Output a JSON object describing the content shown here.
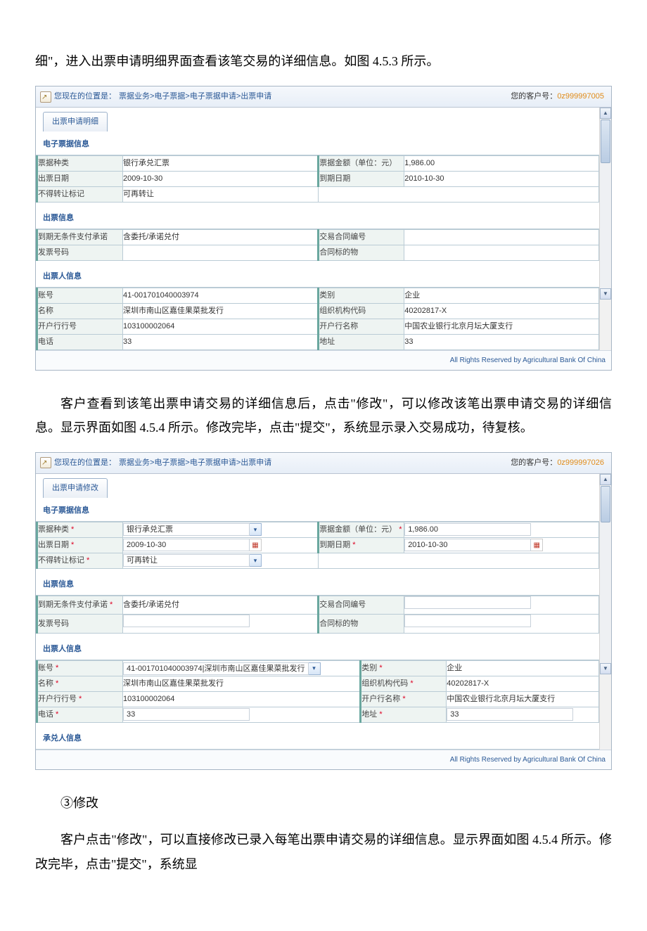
{
  "doc": {
    "p1": "细\"，进入出票申请明细界面查看该笔交易的详细信息。如图 4.5.3 所示。",
    "p2": "客户查看到该笔出票申请交易的详细信息后，点击\"修改\"，可以修改该笔出票申请交易的详细信息。显示界面如图 4.5.4 所示。修改完毕，点击\"提交\"，系统显示录入交易成功，待复核。",
    "p3": "③修改",
    "p4": "客户点击\"修改\"，可以直接修改已录入每笔出票申请交易的详细信息。显示界面如图 4.5.4 所示。修改完毕，点击\"提交\"，系统显"
  },
  "app1": {
    "loc_label": "您现在的位置是：",
    "breadcrumb": "票据业务>电子票据>电子票据申请>出票申请",
    "cust_label": "您的客户号：",
    "cust_id": "0z999997005",
    "tab": "出票申请明细",
    "section1": "电子票据信息",
    "r1": {
      "l1": "票据种类",
      "v1": "银行承兑汇票",
      "l2": "票据金额（单位：元）",
      "v2": "1,986.00"
    },
    "r2": {
      "l1": "出票日期",
      "v1": "2009-10-30",
      "l2": "到期日期",
      "v2": "2010-10-30"
    },
    "r3": {
      "l1": "不得转让标记",
      "v1": "可再转让"
    },
    "section2": "出票信息",
    "r4": {
      "l1": "到期无条件支付承诺",
      "v1": "含委托/承诺兑付",
      "l2": "交易合同编号",
      "v2": ""
    },
    "r5": {
      "l1": "发票号码",
      "v1": "",
      "l2": "合同标的物",
      "v2": ""
    },
    "section3": "出票人信息",
    "r6": {
      "l1": "账号",
      "v1": "41-001701040003974",
      "l2": "类别",
      "v2": "企业"
    },
    "r7": {
      "l1": "名称",
      "v1": "深圳市南山区嘉佳果菜批发行",
      "l2": "组织机构代码",
      "v2": "40202817-X"
    },
    "r8": {
      "l1": "开户行行号",
      "v1": "103100002064",
      "l2": "开户行名称",
      "v2": "中国农业银行北京月坛大厦支行"
    },
    "r9": {
      "l1": "电话",
      "v1": "33",
      "l2": "地址",
      "v2": "33"
    },
    "footer": "All Rights Reserved by Agricultural Bank Of China"
  },
  "app2": {
    "loc_label": "您现在的位置是：",
    "breadcrumb": "票据业务>电子票据>电子票据申请>出票申请",
    "cust_label": "您的客户号：",
    "cust_id": "0z999997026",
    "tab": "出票申请修改",
    "section1": "电子票据信息",
    "r1": {
      "l1": "票据种类",
      "v1": "银行承兑汇票",
      "l2": "票据金额（单位：元）",
      "v2": "1,986.00"
    },
    "r2": {
      "l1": "出票日期",
      "v1": "2009-10-30",
      "l2": "到期日期",
      "v2": "2010-10-30"
    },
    "r3": {
      "l1": "不得转让标记",
      "v1": "可再转让"
    },
    "section2": "出票信息",
    "r4": {
      "l1": "到期无条件支付承诺",
      "v1": "含委托/承诺兑付",
      "l2": "交易合同编号",
      "v2": ""
    },
    "r5": {
      "l1": "发票号码",
      "v1": "",
      "l2": "合同标的物",
      "v2": ""
    },
    "section3": "出票人信息",
    "r6": {
      "l1": "账号",
      "v1": "41-001701040003974|深圳市南山区嘉佳果菜批发行",
      "l2": "类别",
      "v2": "企业"
    },
    "r7": {
      "l1": "名称",
      "v1": "深圳市南山区嘉佳果菜批发行",
      "l2": "组织机构代码",
      "v2": "40202817-X"
    },
    "r8": {
      "l1": "开户行行号",
      "v1": "103100002064",
      "l2": "开户行名称",
      "v2": "中国农业银行北京月坛大厦支行"
    },
    "r9": {
      "l1": "电话",
      "v1": "33",
      "l2": "地址",
      "v2": "33"
    },
    "section4": "承兑人信息",
    "footer": "All Rights Reserved by Agricultural Bank Of China"
  }
}
